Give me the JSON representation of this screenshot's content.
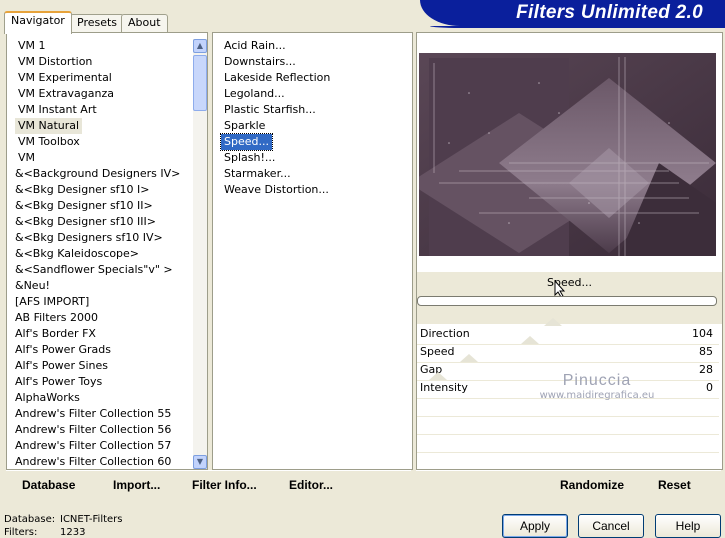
{
  "header": {
    "title": "Filters Unlimited 2.0"
  },
  "tabs": [
    {
      "label": "Navigator"
    },
    {
      "label": "Presets"
    },
    {
      "label": "About"
    }
  ],
  "categories": [
    "VM 1",
    "VM Distortion",
    "VM Experimental",
    "VM Extravaganza",
    "VM Instant Art",
    "VM Natural",
    "VM Toolbox",
    "VM",
    "&<Background Designers IV>",
    "&<Bkg Designer sf10 I>",
    "&<Bkg Designer sf10 II>",
    "&<Bkg Designer sf10 III>",
    "&<Bkg Designers sf10 IV>",
    "&<Bkg Kaleidoscope>",
    "&<Sandflower Specials\"v\" >",
    "&Neu!",
    "[AFS IMPORT]",
    "AB Filters 2000",
    "Alf's Border FX",
    "Alf's Power Grads",
    "Alf's Power Sines",
    "Alf's Power Toys",
    "AlphaWorks",
    "Andrew's Filter Collection 55",
    "Andrew's Filter Collection 56",
    "Andrew's Filter Collection 57",
    "Andrew's Filter Collection 60"
  ],
  "filters": [
    "Acid Rain...",
    "Downstairs...",
    "Lakeside Reflection",
    "Legoland...",
    "Plastic Starfish...",
    "Sparkle",
    "Speed...",
    "Splash!...",
    "Starmaker...",
    "Weave Distortion..."
  ],
  "preview": {
    "filter_name": "Speed...",
    "progress": 0
  },
  "params": [
    {
      "label": "Direction",
      "value": "104",
      "level": 0.41
    },
    {
      "label": "Speed",
      "value": "85",
      "level": 0.33
    },
    {
      "label": "Gap",
      "value": "28",
      "level": 0.11
    },
    {
      "label": "Intensity",
      "value": "0",
      "level": 0.0
    }
  ],
  "watermark": {
    "name": "Pinuccia",
    "url": "www.maidiregrafica.eu"
  },
  "left_buttons": {
    "database": "Database",
    "import": "Import...",
    "filter_info": "Filter Info...",
    "editor": "Editor..."
  },
  "right_buttons": {
    "randomize": "Randomize",
    "reset": "Reset"
  },
  "footer": {
    "database_label": "Database:",
    "database_value": "ICNET-Filters",
    "filters_label": "Filters:",
    "filters_value": "1233",
    "apply": "Apply",
    "cancel": "Cancel",
    "help": "Help"
  },
  "colors": {
    "banner": "#0a1f9c",
    "selection": "#316ac5",
    "preview_base": "#4a3846"
  }
}
